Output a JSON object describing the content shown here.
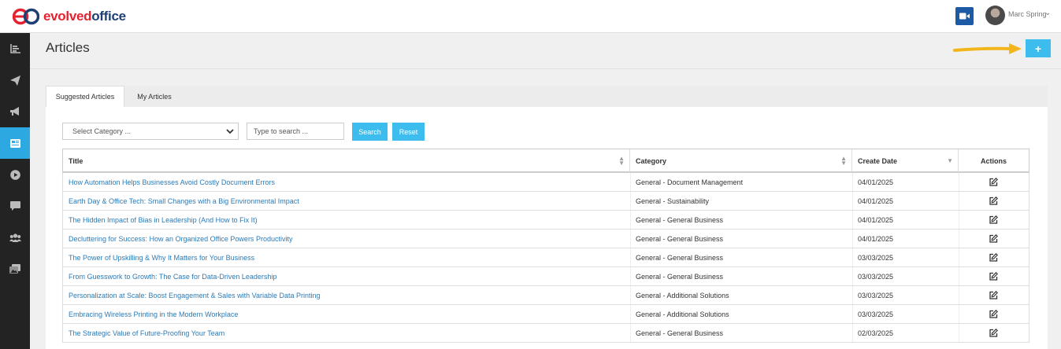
{
  "brand": {
    "name_part1": "evolved",
    "name_part2": "office",
    "accent": "#e62230",
    "navy": "#1d3f73"
  },
  "header": {
    "user_name": "Marc Spring",
    "video_icon": "video-camera-icon",
    "chevron": "⌄"
  },
  "sidebar": {
    "items": [
      {
        "icon": "bar-chart-icon",
        "active": false
      },
      {
        "icon": "paper-plane-icon",
        "active": false
      },
      {
        "icon": "megaphone-icon",
        "active": false
      },
      {
        "icon": "newspaper-icon",
        "active": true
      },
      {
        "icon": "play-circle-icon",
        "active": false
      },
      {
        "icon": "chat-icon",
        "active": false
      },
      {
        "icon": "users-icon",
        "active": false
      },
      {
        "icon": "images-icon",
        "active": false
      }
    ]
  },
  "page": {
    "title": "Articles",
    "add_label": "+"
  },
  "tabs": [
    {
      "label": "Suggested Articles",
      "active": true
    },
    {
      "label": "My Articles",
      "active": false
    }
  ],
  "filters": {
    "category_selected": "Select Category ...",
    "search_placeholder": "Type to search ...",
    "search_label": "Search",
    "reset_label": "Reset"
  },
  "table": {
    "columns": [
      "Title",
      "Category",
      "Create Date",
      "Actions"
    ],
    "rows": [
      {
        "title": "How Automation Helps Businesses Avoid Costly Document Errors",
        "category": "General - Document Management",
        "date": "04/01/2025"
      },
      {
        "title": "Earth Day & Office Tech: Small Changes with a Big Environmental Impact",
        "category": "General - Sustainability",
        "date": "04/01/2025"
      },
      {
        "title": "The Hidden Impact of Bias in Leadership (And How to Fix It)",
        "category": "General - General Business",
        "date": "04/01/2025"
      },
      {
        "title": "Decluttering for Success: How an Organized Office Powers Productivity",
        "category": "General - General Business",
        "date": "04/01/2025"
      },
      {
        "title": "The Power of Upskilling & Why It Matters for Your Business",
        "category": "General - General Business",
        "date": "03/03/2025"
      },
      {
        "title": "From Guesswork to Growth: The Case for Data-Driven Leadership",
        "category": "General - General Business",
        "date": "03/03/2025"
      },
      {
        "title": "Personalization at Scale: Boost Engagement & Sales with Variable Data Printing",
        "category": "General - Additional Solutions",
        "date": "03/03/2025"
      },
      {
        "title": "Embracing Wireless Printing in the Modern Workplace",
        "category": "General - Additional Solutions",
        "date": "03/03/2025"
      },
      {
        "title": "The Strategic Value of Future-Proofing Your Team",
        "category": "General - General Business",
        "date": "02/03/2025"
      }
    ]
  }
}
